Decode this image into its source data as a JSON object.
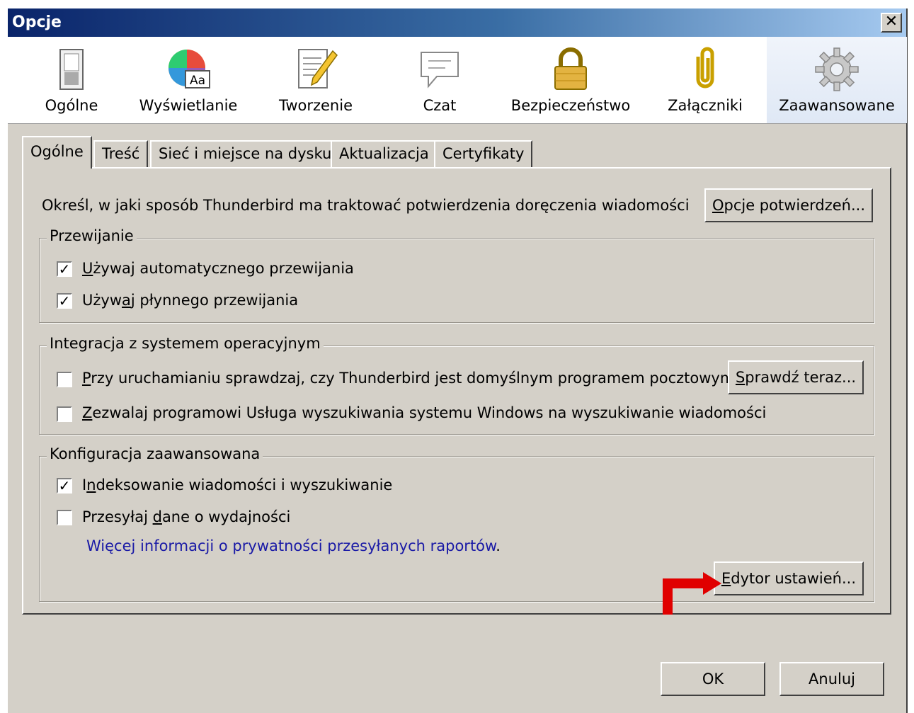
{
  "window": {
    "title": "Opcje",
    "close_label": "✕"
  },
  "toolbar": {
    "panes": [
      {
        "label": "Ogólne",
        "icon": "switch-icon"
      },
      {
        "label": "Wyświetlanie",
        "icon": "color-palette-icon",
        "icon_text": "Aa"
      },
      {
        "label": "Tworzenie",
        "icon": "document-pencil-icon"
      },
      {
        "label": "Czat",
        "icon": "speech-bubble-icon"
      },
      {
        "label": "Bezpieczeństwo",
        "icon": "padlock-icon"
      },
      {
        "label": "Załączniki",
        "icon": "paperclip-icon"
      },
      {
        "label": "Zaawansowane",
        "icon": "gear-icon"
      }
    ],
    "selected": "Zaawansowane"
  },
  "tabs": [
    "Ogólne",
    "Treść",
    "Sieć i miejsce na dysku",
    "Aktualizacja",
    "Certyfikaty"
  ],
  "active_tab": "Ogólne",
  "general": {
    "receipts_text": "Określ, w jaki sposób Thunderbird ma traktować potwierdzenia doręczenia wiadomości",
    "receipts_button": "Opcje potwierdzeń..."
  },
  "scrolling": {
    "legend": "Przewijanie",
    "autoscroll": {
      "label": "Używaj automatycznego przewijania",
      "checked": true
    },
    "smooth": {
      "label": "Używaj płynnego przewijania",
      "checked": true
    }
  },
  "integration": {
    "legend": "Integracja z systemem operacyjnym",
    "default_check": {
      "label": "Przy uruchamianiu sprawdzaj, czy Thunderbird jest domyślnym programem pocztowym",
      "checked": false
    },
    "check_now_button": "Sprawdź teraz...",
    "search": {
      "label": "Zezwalaj programowi Usługa wyszukiwania systemu Windows na wyszukiwanie wiadomości",
      "checked": false
    }
  },
  "advanced": {
    "legend": "Konfiguracja zaawansowana",
    "indexing": {
      "label": "Indeksowanie wiadomości i wyszukiwanie",
      "checked": true
    },
    "telemetry": {
      "label": "Przesyłaj dane o wydajności",
      "checked": false
    },
    "privacy_link": "Więcej informacji o prywatności przesyłanych raportów",
    "privacy_link_suffix": ".",
    "config_editor_button": "Edytor ustawień..."
  },
  "footer": {
    "ok": "OK",
    "cancel": "Anuluj"
  },
  "colors": {
    "face": "#d4d0c8",
    "title_start": "#0a246a",
    "link": "#1a1aa6",
    "annotation_arrow": "#e00000"
  }
}
